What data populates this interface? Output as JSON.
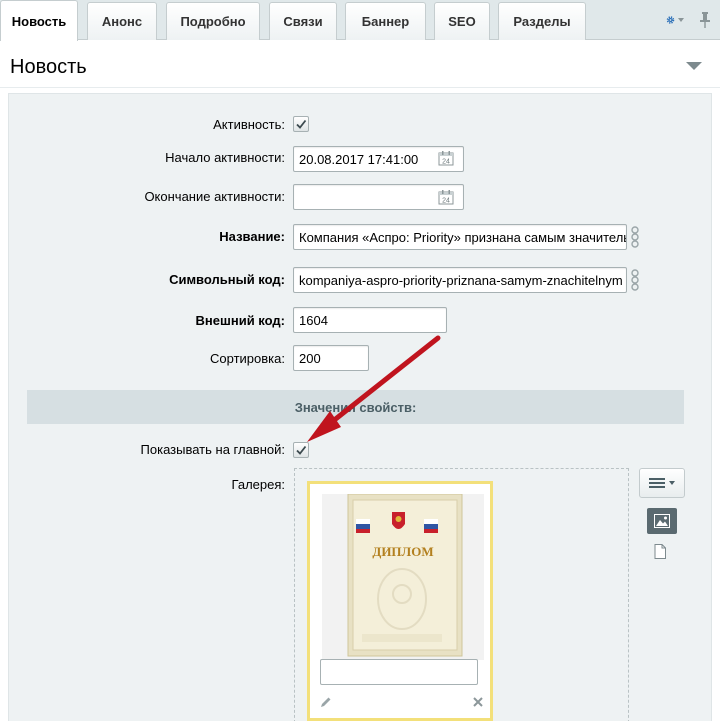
{
  "tabs": [
    {
      "label": "Новость"
    },
    {
      "label": "Анонс"
    },
    {
      "label": "Подробно"
    },
    {
      "label": "Связи"
    },
    {
      "label": "Баннер"
    },
    {
      "label": "SEO"
    },
    {
      "label": "Разделы"
    }
  ],
  "section": {
    "title": "Новость"
  },
  "form": {
    "active_label": "Активность:",
    "active_checked": true,
    "start_label": "Начало активности:",
    "start_value": "20.08.2017 17:41:00",
    "end_label": "Окончание активности:",
    "end_value": "",
    "name_label": "Название:",
    "name_value": "Компания «Аспро: Priority» признана самым значительным",
    "code_label": "Символьный код:",
    "code_value": "kompaniya-aspro-priority-priznana-samym-znachitelnym",
    "ext_label": "Внешний код:",
    "ext_value": "1604",
    "sort_label": "Сортировка:",
    "sort_value": "200"
  },
  "properties": {
    "header": "Значения свойств:",
    "show_main_label": "Показывать на главной:",
    "show_main_checked": true,
    "gallery_label": "Галерея:",
    "gallery_item": {
      "image": "diploma-image",
      "caption": "ДИПЛОМ",
      "name_value": ""
    }
  },
  "icons": {
    "settings": "gear-icon",
    "pin": "pin-icon",
    "calendar": "calendar-icon",
    "link": "link-icon",
    "menu": "menu-lines-icon",
    "image": "image-icon",
    "file": "file-icon",
    "edit": "pencil-icon",
    "delete": "close-icon",
    "annotation": "red-arrow-icon"
  },
  "colors": {
    "accent_blue": "#2a6fb8",
    "annotation_red": "#c0141e",
    "panel_bg": "#eef2f3",
    "active_item_border": "#f3e07a"
  }
}
